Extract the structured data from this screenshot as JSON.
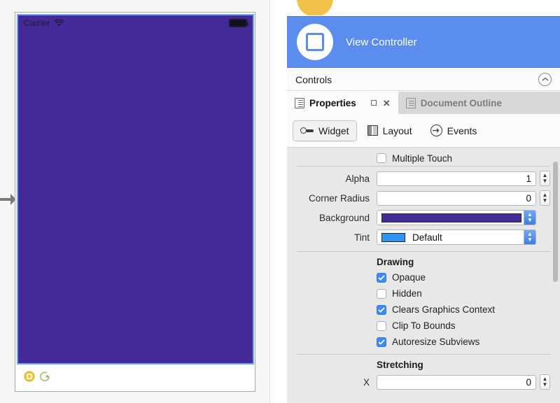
{
  "canvas": {
    "arrow_icon": "right-arrow-icon",
    "device": {
      "status_bar": {
        "carrier": "Carrier",
        "wifi_icon": "wifi-icon",
        "battery_icon": "battery-icon"
      },
      "screen_background_color": "#442a96",
      "selection_border_color": "#6fa8f5",
      "toolbar": {
        "items": [
          {
            "icon": "view-controller-dot-icon",
            "color": "#f0c030"
          },
          {
            "icon": "exit-segue-icon",
            "color": "#8fbf5f"
          }
        ]
      }
    }
  },
  "outline": {
    "top_partial_node_color": "#f2c14b",
    "selected_row": {
      "label": "View Controller",
      "icon": "view-controller-icon",
      "highlight_color": "#5b8def"
    },
    "controls_section": {
      "label": "Controls",
      "collapse_icon": "chevron-up-circle-icon"
    }
  },
  "tabs": [
    {
      "label": "Properties",
      "icon": "properties-icon",
      "active": true,
      "has_close": true,
      "close_icon": "close-icon",
      "restore_icon": "restore-window-icon"
    },
    {
      "label": "Document Outline",
      "icon": "document-outline-icon",
      "active": false,
      "has_close": false
    }
  ],
  "modes": [
    {
      "label": "Widget",
      "icon": "widget-icon",
      "selected": true
    },
    {
      "label": "Layout",
      "icon": "layout-icon",
      "selected": false
    },
    {
      "label": "Events",
      "icon": "events-arrow-icon",
      "selected": false
    }
  ],
  "properties": {
    "multiple_touch": {
      "label": "Multiple Touch",
      "checked": false
    },
    "fields": [
      {
        "label": "Alpha",
        "value": "1",
        "type": "stepper"
      },
      {
        "label": "Corner Radius",
        "value": "0",
        "type": "stepper"
      }
    ],
    "background": {
      "label": "Background",
      "swatch_color": "#442a96",
      "type": "color-popup"
    },
    "tint": {
      "label": "Tint",
      "value": "Default",
      "swatch_color": "#2f93f0",
      "type": "color-popup"
    },
    "drawing": {
      "title": "Drawing",
      "checkboxes": [
        {
          "label": "Opaque",
          "checked": true
        },
        {
          "label": "Hidden",
          "checked": false
        },
        {
          "label": "Clears Graphics Context",
          "checked": true
        },
        {
          "label": "Clip To Bounds",
          "checked": false
        },
        {
          "label": "Autoresize Subviews",
          "checked": true
        }
      ]
    },
    "stretching": {
      "title": "Stretching",
      "first_field_label": "X",
      "first_field_value": "0"
    }
  }
}
